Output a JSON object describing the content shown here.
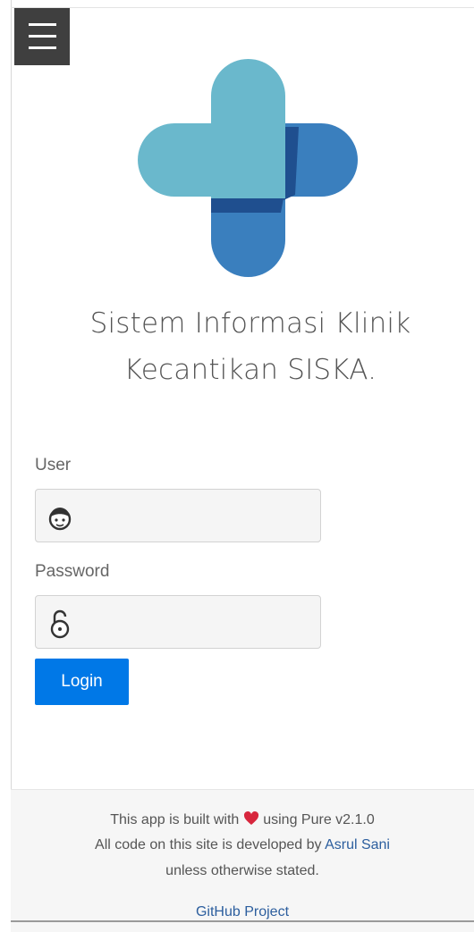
{
  "menu": {
    "icon": "hamburger-icon"
  },
  "site": {
    "title_line1": "Sistem Informasi Klinik",
    "title_line2": "Kecantikan SISKA."
  },
  "login_form": {
    "user_label": "User",
    "user_value": "",
    "user_icon": "user-face-icon",
    "password_label": "Password",
    "password_value": "",
    "password_icon": "lock-icon",
    "login_label": "Login"
  },
  "footer": {
    "line1_before": "This app is built with",
    "heart_icon": "heart-icon",
    "line1_after": "using Pure v2.1.0",
    "line2_before": "All code on this site is developed by",
    "author_link": "Asrul Sani",
    "line3": "unless otherwise stated.",
    "github_link": "GitHub Project"
  },
  "colors": {
    "primary_button": "#0078e7",
    "logo_light": "#6ab8cc",
    "logo_dark": "#3a7fbe",
    "heart": "#d7263d",
    "link": "#2c5e9e"
  }
}
